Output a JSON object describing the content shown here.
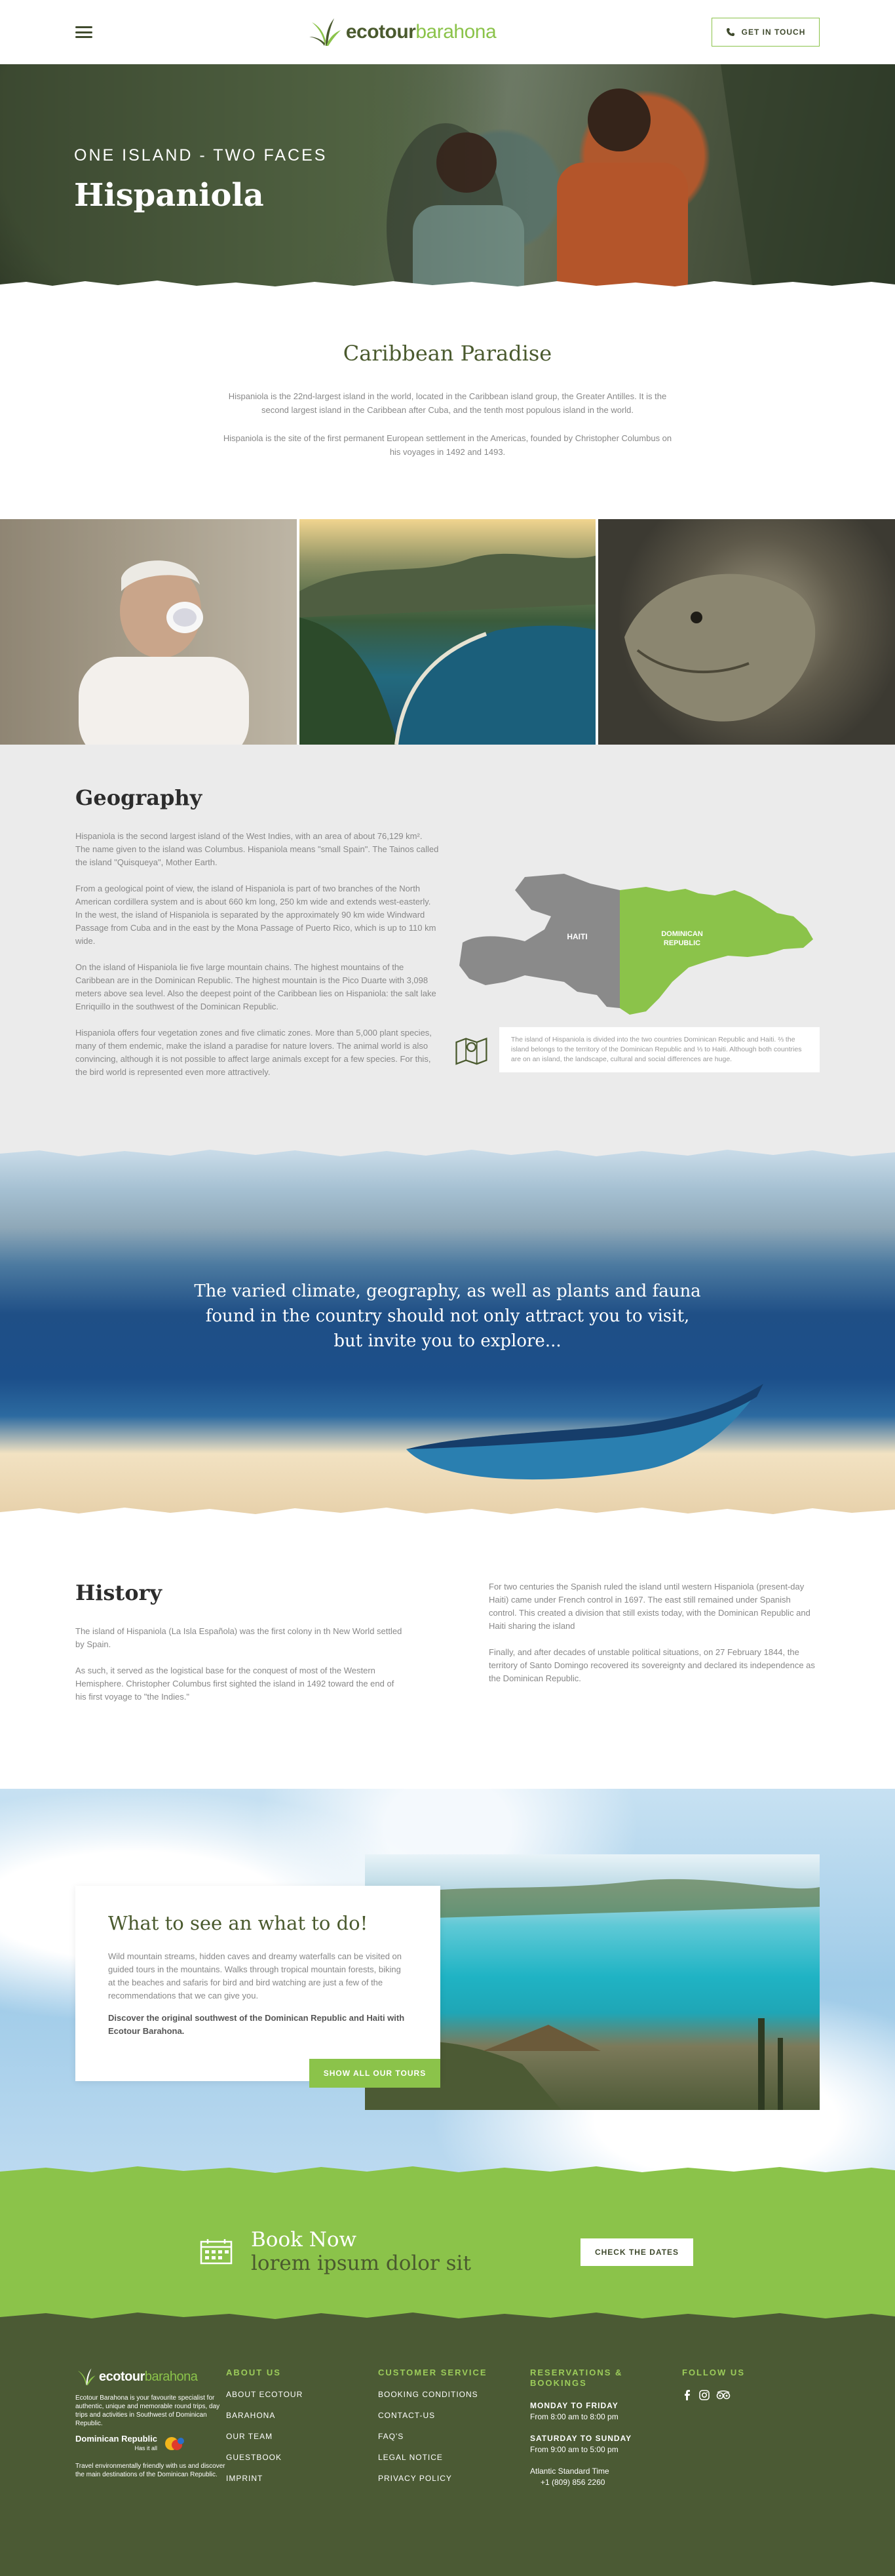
{
  "header": {
    "logo_eco": "ecotour",
    "logo_barahona": "barahona",
    "contact_label": "Get in touch"
  },
  "hero": {
    "kicker": "One Island - Two Faces",
    "title": "Hispaniola"
  },
  "intro": {
    "title": "Caribbean Paradise",
    "p1": "Hispaniola is the 22nd-largest island in the world, located in the Caribbean island group, the Greater Antilles. It is the second largest island in the Caribbean after Cuba, and the tenth most populous island in the world.",
    "p2": "Hispaniola is the site of the first permanent European settlement in the Americas, founded by Christopher Columbus on his voyages in 1492 and 1493."
  },
  "geography": {
    "title": "Geography",
    "p1": "Hispaniola is the second largest island of the West Indies, with an area of about 76,129 km². The name given to the island was Columbus. Hispaniola means \"small Spain\". The Tainos called the island \"Quisqueya\", Mother Earth.",
    "p2": "From a geological point of view, the island of Hispaniola is part of two branches of the North American cordillera system and is about 660 km long, 250 km wide and extends west-easterly. In the west, the island of Hispaniola is separated by the approximately 90 km wide Windward Passage from Cuba and in the east by the Mona Passage of Puerto Rico, which is up to 110 km wide.",
    "p3": "On the island of Hispaniola lie five large mountain chains. The highest mountains of the Caribbean are in the Dominican Republic. The highest mountain is the Pico Duarte with 3,098 meters above sea level. Also the deepest point of the Caribbean lies on Hispaniola: the salt lake Enriquillo in the southwest of the Dominican Republic.",
    "p4": "Hispaniola offers four vegetation zones and five climatic zones. More than 5,000 plant species, many of them endemic, make the island a paradise for nature lovers. The animal world is also convincing, although it is not possible to affect large animals except for a few species. For this, the bird world is represented even more attractively.",
    "map_haiti": "HAITI",
    "map_dr_line1": "DOMINICAN",
    "map_dr_line2": "REPUBLIC",
    "map_note": "The island of Hispaniola is divided into the two countries Dominican Republic and Haiti. ⅔ the island belongs to the territory of the Dominican Republic and ⅓ to Haiti. Although both countries are on an island, the landscape, cultural and social differences are huge."
  },
  "ocean": {
    "line1": "The varied climate, geography, as well as plants and fauna",
    "line2": "found in the country should not only attract you to visit,",
    "line3": "but invite you to explore..."
  },
  "history": {
    "title": "History",
    "p1": "The island of Hispaniola (La Isla Española) was the first colony in th New World settled by Spain.",
    "p2": "As such, it served as the logistical base for the conquest of most of the Western Hemisphere. Christopher Columbus first sighted the island in 1492 toward the end of his first voyage to \"the Indies.\"",
    "p3": "For two centuries the Spanish ruled the island until western Hispaniola (present-day Haiti) came under French control in 1697. The east still remained under Spanish control. This created a division that still exists today, with the Dominican Republic and Haiti sharing the island",
    "p4": "Finally, and after decades of unstable political situations, on 27 February 1844, the territory of Santo Domingo recovered its sovereignty and declared its independence as the Dominican Republic."
  },
  "todo": {
    "title": "What to see an what to do!",
    "p1": "Wild mountain streams, hidden caves and dreamy waterfalls can be visited on guided tours in the mountains. Walks through tropical mountain forests, biking at the beaches and safaris for bird and bird watching are just a few of the recommendations that we can give you.",
    "p2": "Discover the original southwest of the Dominican Republic and Haiti with Ecotour Barahona.",
    "button": "Show all our tours"
  },
  "book": {
    "title": "Book Now",
    "subtitle": "lorem ipsum dolor sit",
    "button": "Check the dates"
  },
  "footer": {
    "logo_eco": "ecotour",
    "logo_barahona": "barahona",
    "about_text": "Ecotour Barahona is your favourite specialist for authentic, unique and memorable round trips, day trips and activities in Southwest of Dominican Republic.",
    "dr_name": "Dominican Republic",
    "dr_tag": "Has it all",
    "eco_text": "Travel environmentally friendly with us and discover the main destinations of the Dominican Republic.",
    "about_title": "About us",
    "about_links": [
      "About Ecotour",
      "Barahona",
      "Our Team",
      "Guestbook",
      "Imprint"
    ],
    "service_title": "Customer Service",
    "service_links": [
      "Booking Conditions",
      "Contact-us",
      "FAQ's",
      "Legal Notice",
      "Privacy Policy"
    ],
    "res_title": "Reservations & Bookings",
    "res_weekday_label": "Monday to Friday",
    "res_weekday_hours": "From 8:00 am to 8:00 pm",
    "res_weekend_label": "Saturday to Sunday",
    "res_weekend_hours": "From 9:00 am to 5:00 pm",
    "res_tz": "Atlantic Standard Time",
    "res_phone": "+1 (809) 856 2260",
    "follow_title": "Follow us"
  },
  "colors": {
    "brand_green": "#8bc34a",
    "dark_olive": "#4b5a34",
    "geo_bg": "#ebebeb"
  }
}
